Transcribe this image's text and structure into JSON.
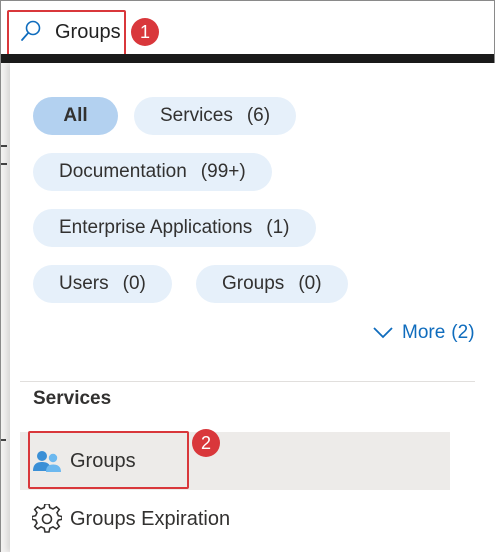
{
  "search": {
    "value": "Groups",
    "callout": "1"
  },
  "filters": {
    "all": "All",
    "services": {
      "label": "Services",
      "count": "(6)"
    },
    "documentation": {
      "label": "Documentation",
      "count": "(99+)"
    },
    "enterprise": {
      "label": "Enterprise Applications",
      "count": "(1)"
    },
    "users": {
      "label": "Users",
      "count": "(0)"
    },
    "groups": {
      "label": "Groups",
      "count": "(0)"
    }
  },
  "more": {
    "label": "More",
    "count": "(2)"
  },
  "services_section": {
    "title": "Services",
    "callout": "2",
    "items": [
      {
        "label": "Groups",
        "icon": "groups-icon"
      },
      {
        "label": "Groups Expiration",
        "icon": "gear-icon"
      }
    ]
  },
  "colors": {
    "accent": "#0f6cbd",
    "callout_red": "#d9373b",
    "pill_bg": "#e6f0fa",
    "pill_active_bg": "#b3d1f0"
  }
}
